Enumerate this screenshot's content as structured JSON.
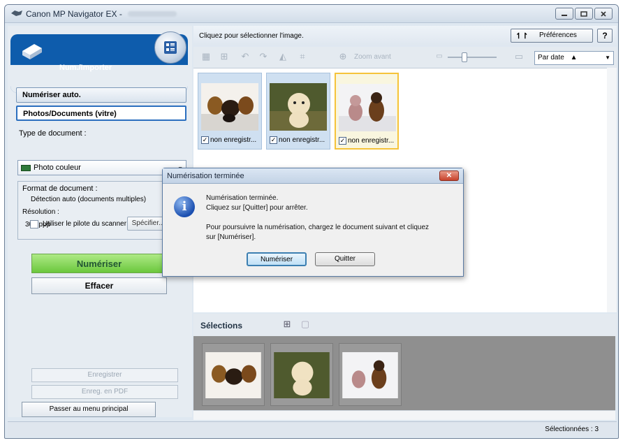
{
  "window": {
    "title": "Canon MP Navigator EX -"
  },
  "left_panel": {
    "header_label": "Num./Importer",
    "mode_auto": "Numériser auto.",
    "mode_photos": "Photos/Documents (vitre)",
    "doc_type_label": "Type de document :",
    "doc_type_value": "Photo couleur",
    "format_label": "Format de document :",
    "format_value": "Détection auto (documents multiples)",
    "resolution_label": "Résolution :",
    "resolution_value": "300 ppp",
    "specify_button": "Spécifier...",
    "use_driver_label": "Utiliser le pilote du scanner",
    "scan_button": "Numériser",
    "clear_button": "Effacer",
    "save_button": "Enregistrer",
    "save_pdf_button": "Enreg. en PDF",
    "main_menu_button": "Passer au menu principal"
  },
  "right_panel": {
    "hint": "Cliquez pour sélectionner l'image.",
    "preferences_button": "Préférences",
    "help_button": "?",
    "zoom_label": "Zoom avant",
    "sort_value": "Par date",
    "thumbnails": [
      {
        "caption": "non enregistr...",
        "checked": true,
        "selected": false
      },
      {
        "caption": "non enregistr...",
        "checked": true,
        "selected": false
      },
      {
        "caption": "non enregistr...",
        "checked": true,
        "selected": true
      }
    ],
    "selections_title": "Sélections"
  },
  "status": {
    "selected_text": "Sélectionnées : 3"
  },
  "dialog": {
    "title": "Numérisation terminée",
    "line1": "Numérisation terminée.",
    "line2": "Cliquez sur [Quitter] pour arrêter.",
    "line3": "Pour poursuivre la numérisation, chargez le document suivant et cliquez",
    "line4": "sur [Numériser].",
    "scan_button": "Numériser",
    "quit_button": "Quitter"
  },
  "colors": {
    "header_blue": "#0e5cac",
    "scan_green": "#6bc73d",
    "selected_thumb_border": "#f5c33a"
  }
}
